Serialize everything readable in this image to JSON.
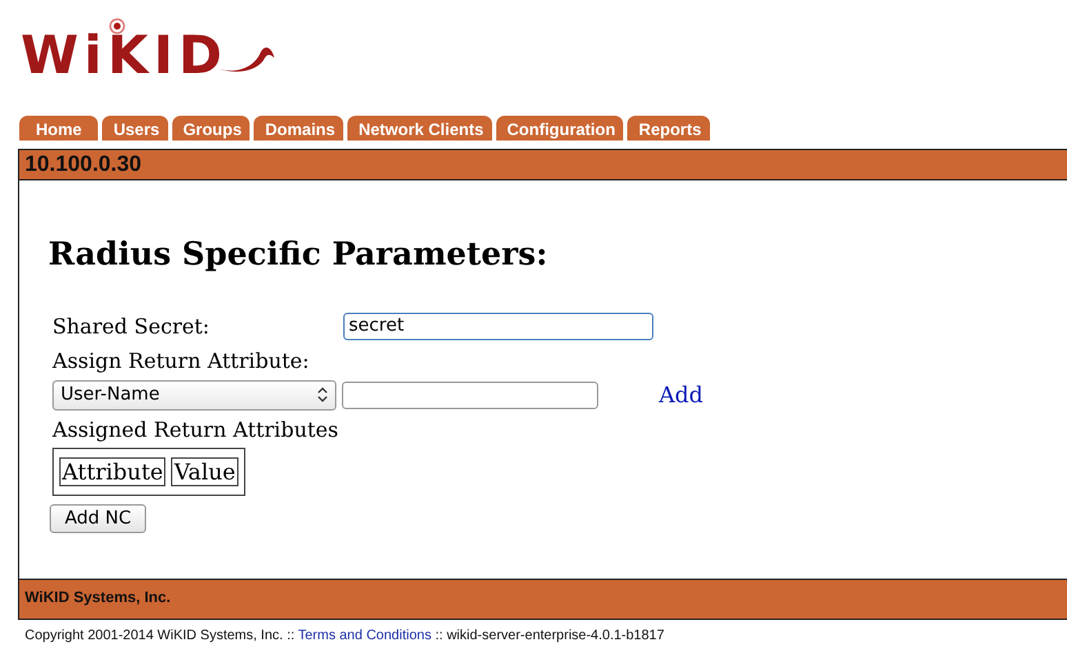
{
  "logo": {
    "text": "WiKID"
  },
  "tabs": [
    {
      "label": "Home",
      "selected": false
    },
    {
      "label": "Users",
      "selected": false
    },
    {
      "label": "Groups",
      "selected": false
    },
    {
      "label": "Domains",
      "selected": false
    },
    {
      "label": "Network Clients",
      "selected": false
    },
    {
      "label": "Configuration",
      "selected": false
    },
    {
      "label": "Reports",
      "selected": false
    }
  ],
  "panel_title": "10.100.0.30",
  "heading": "Radius Specific Parameters:",
  "shared_secret": {
    "label": "Shared Secret:",
    "value": "secret"
  },
  "assign_label": "Assign Return Attribute:",
  "attribute_select": {
    "value": "User-Name"
  },
  "add_link": "Add",
  "assigned_label": "Assigned Return Attributes",
  "table": {
    "columns": [
      "Attribute",
      "Value"
    ]
  },
  "submit_button": "Add NC",
  "footer": "WiKID Systems, Inc.",
  "copyright": {
    "text": "Copyright 2001-2014 WiKID Systems, Inc. ::",
    "link": "Terms and Conditions",
    "version": ":: wikid-server-enterprise-4.0.1-b1817"
  }
}
